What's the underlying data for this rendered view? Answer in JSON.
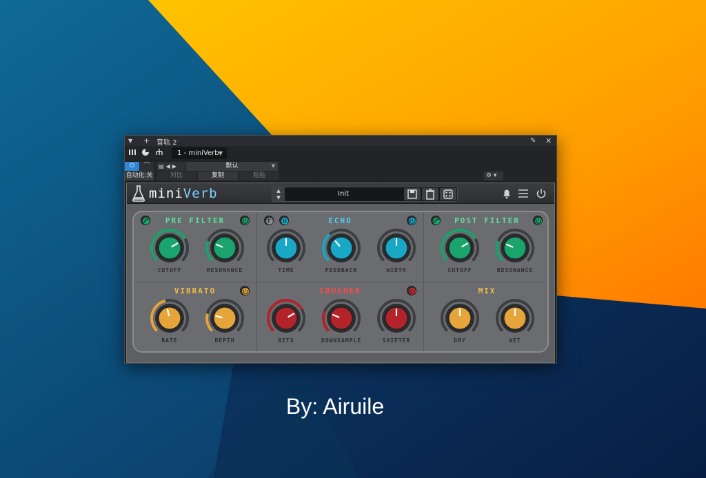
{
  "host": {
    "title": "音轨 2",
    "device": "1 - miniVerb",
    "preset": "默认",
    "auto_off": "自动化:关",
    "compare": "对比",
    "copy": "复制",
    "paste": "粘贴"
  },
  "plugin": {
    "brand_a": "mini",
    "brand_b": "Verb",
    "preset_name": "Init",
    "sections": {
      "pre_filter": {
        "title": "PRE FILTER",
        "knobs": {
          "cutoff": {
            "label": "CUTOFF",
            "value": 0.72
          },
          "resonance": {
            "label": "RESONANCE",
            "value": 0.25
          }
        }
      },
      "echo": {
        "title": "ECHO",
        "knobs": {
          "time": {
            "label": "TIME",
            "value": 0.5
          },
          "feedback": {
            "label": "FEEDBACK",
            "value": 0.35
          },
          "width": {
            "label": "WIDTH",
            "value": 0.5
          }
        }
      },
      "post_filter": {
        "title": "POST FILTER",
        "knobs": {
          "cutoff": {
            "label": "CUTOFF",
            "value": 0.72
          },
          "resonance": {
            "label": "RESONANCE",
            "value": 0.25
          }
        }
      },
      "vibrato": {
        "title": "VIBRATO",
        "knobs": {
          "rate": {
            "label": "RATE",
            "value": 0.45
          },
          "depth": {
            "label": "DEPTH",
            "value": 0.22
          }
        }
      },
      "crusher": {
        "title": "CRUSHER",
        "knobs": {
          "bits": {
            "label": "BITS",
            "value": 0.72
          },
          "downsample": {
            "label": "DOWNSAMPLE",
            "value": 0.25
          },
          "shifter": {
            "label": "SHIFTER",
            "value": 0.5
          }
        }
      },
      "mix": {
        "title": "MIX",
        "knobs": {
          "dry": {
            "label": "DRY",
            "value": 0.5
          },
          "wet": {
            "label": "WET",
            "value": 0.5
          }
        }
      }
    }
  },
  "byline": "By:  Airuile",
  "colors": {
    "green": "#1aa36a",
    "teal": "#19a7c6",
    "orange": "#e5a53a",
    "red": "#b3242a",
    "green_title": "#5ee0a0",
    "teal_title": "#55d2f5",
    "orange_title": "#f3b94a",
    "red_title": "#ff4b4b"
  }
}
